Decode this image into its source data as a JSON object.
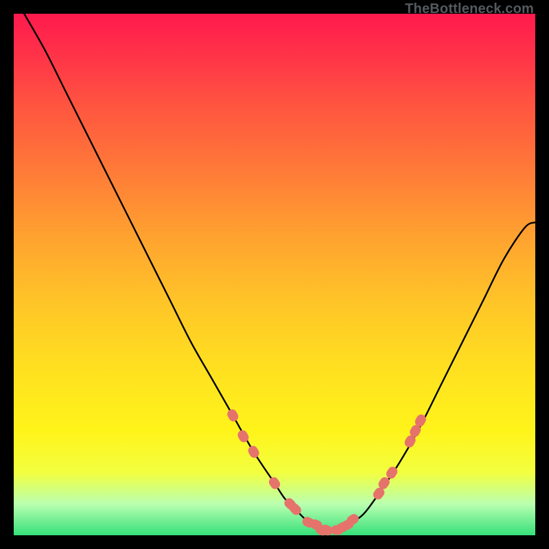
{
  "attribution": "TheBottleneck.com",
  "colors": {
    "frame_bg": "#000000",
    "gradient_top": "#ff1a4d",
    "gradient_bottom": "#35e07a",
    "curve_stroke": "#000000",
    "marker_fill": "#e6736b",
    "marker_stroke": "#d85a52"
  },
  "chart_data": {
    "type": "line",
    "title": "",
    "xlabel": "",
    "ylabel": "",
    "xlim": [
      0,
      100
    ],
    "ylim": [
      0,
      100
    ],
    "grid": false,
    "legend": false,
    "series": [
      {
        "name": "curve",
        "x": [
          2,
          6,
          10,
          14,
          18,
          22,
          26,
          30,
          34,
          38,
          42,
          46,
          50,
          52,
          54,
          56,
          58,
          60,
          62,
          64,
          67,
          70,
          74,
          78,
          82,
          86,
          90,
          94,
          98,
          100
        ],
        "y": [
          100,
          93,
          85,
          77,
          69,
          61,
          53,
          45,
          37,
          30,
          23,
          16,
          10,
          7,
          5,
          3,
          2,
          1,
          1,
          2,
          4,
          8,
          14,
          21,
          29,
          37,
          45,
          53,
          59,
          60
        ]
      }
    ],
    "markers": [
      {
        "x": 42,
        "y": 23
      },
      {
        "x": 44,
        "y": 19
      },
      {
        "x": 46,
        "y": 16
      },
      {
        "x": 50,
        "y": 10
      },
      {
        "x": 53,
        "y": 6
      },
      {
        "x": 54,
        "y": 5
      },
      {
        "x": 56.5,
        "y": 2.5
      },
      {
        "x": 58,
        "y": 2
      },
      {
        "x": 59,
        "y": 1
      },
      {
        "x": 60,
        "y": 1
      },
      {
        "x": 62,
        "y": 1
      },
      {
        "x": 63,
        "y": 1.5
      },
      {
        "x": 64,
        "y": 2
      },
      {
        "x": 65,
        "y": 3
      },
      {
        "x": 70,
        "y": 8
      },
      {
        "x": 71,
        "y": 10
      },
      {
        "x": 72.5,
        "y": 12
      },
      {
        "x": 76,
        "y": 18
      },
      {
        "x": 77,
        "y": 20
      },
      {
        "x": 78,
        "y": 22
      }
    ],
    "annotations": []
  }
}
